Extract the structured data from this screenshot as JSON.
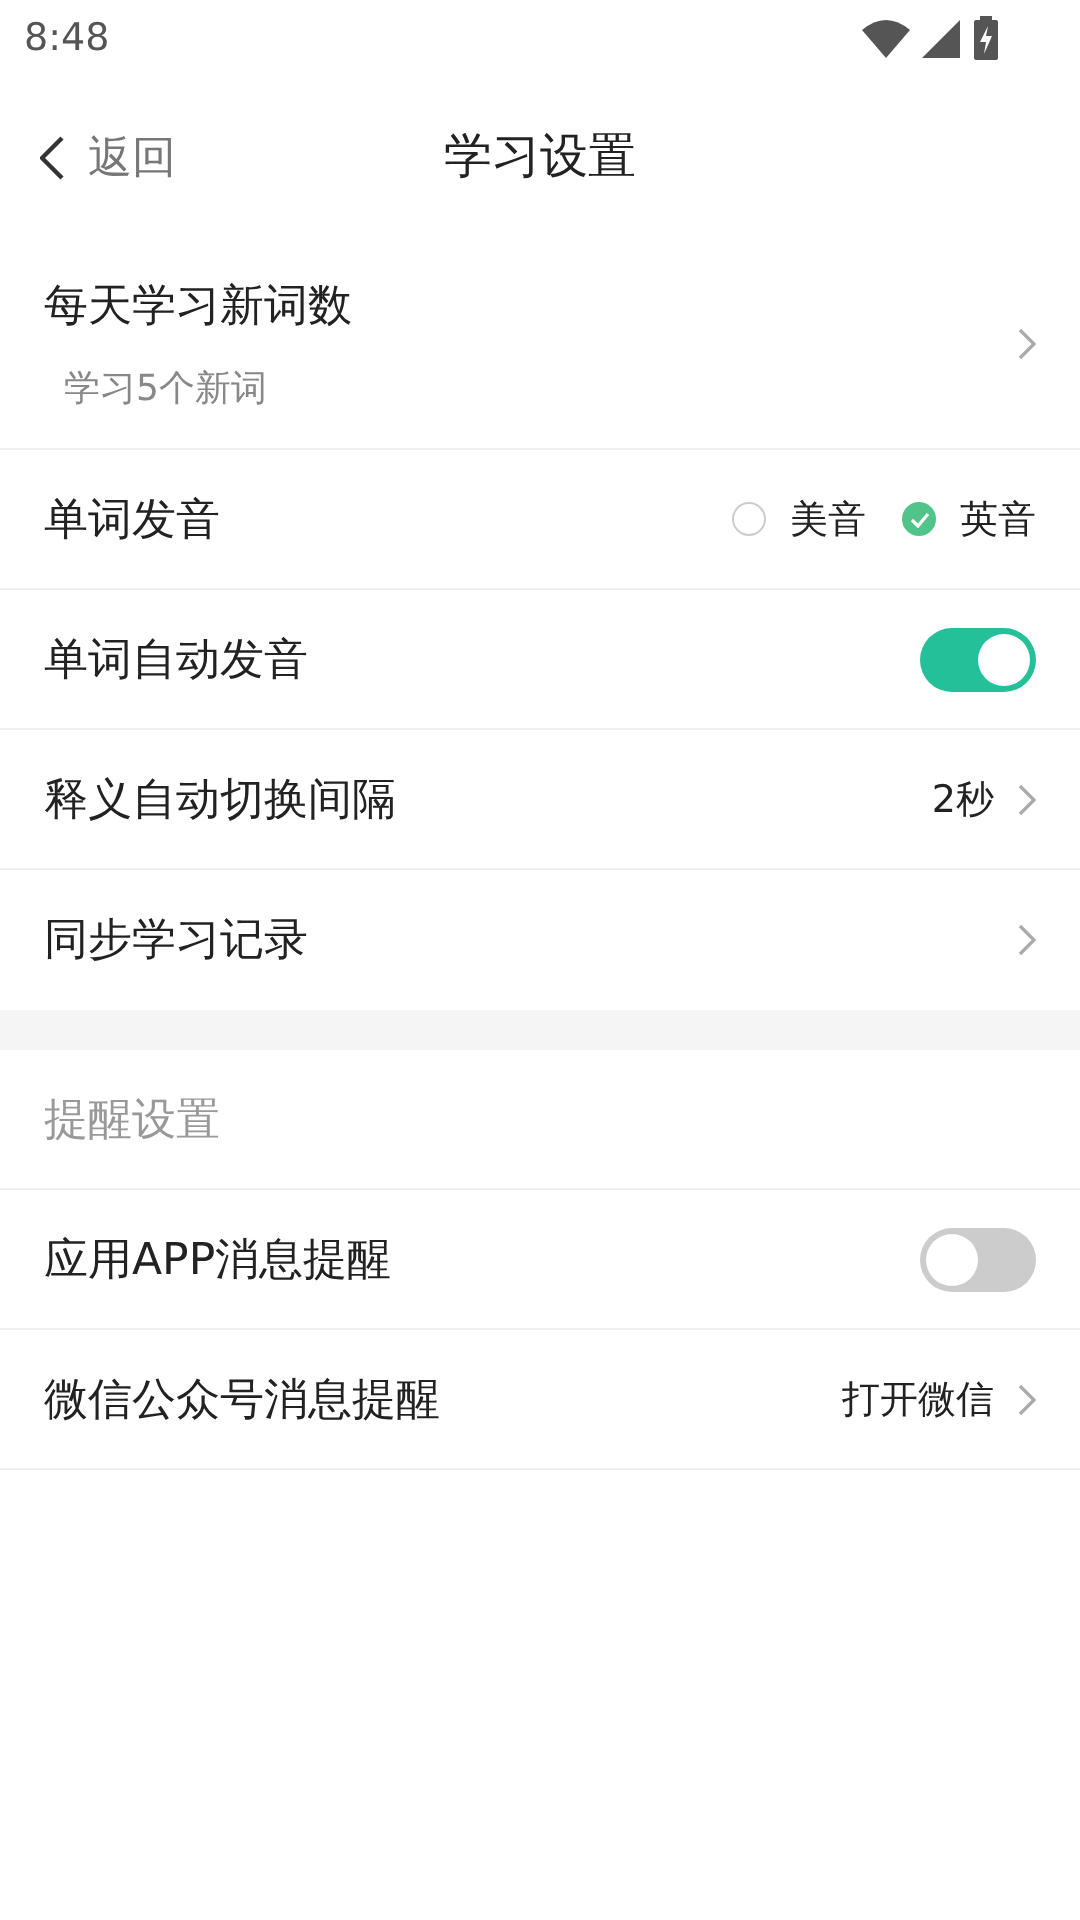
{
  "status_bar": {
    "time": "8:48"
  },
  "header": {
    "back_label": "返回",
    "title": "学习设置"
  },
  "sections": [
    {
      "rows": [
        {
          "kind": "nav",
          "label": "每天学习新词数",
          "subtitle": "学习5个新词"
        },
        {
          "kind": "radio",
          "label": "单词发音",
          "options": [
            {
              "label": "美音",
              "selected": false
            },
            {
              "label": "英音",
              "selected": true
            }
          ]
        },
        {
          "kind": "toggle",
          "label": "单词自动发音",
          "on": true
        },
        {
          "kind": "nav",
          "label": "释义自动切换间隔",
          "value": "2秒"
        },
        {
          "kind": "nav",
          "label": "同步学习记录"
        }
      ]
    },
    {
      "rows": [
        {
          "kind": "header",
          "label": "提醒设置"
        },
        {
          "kind": "toggle",
          "label": "应用APP消息提醒",
          "on": false
        },
        {
          "kind": "nav",
          "label": "微信公众号消息提醒",
          "value": "打开微信"
        }
      ]
    }
  ]
}
